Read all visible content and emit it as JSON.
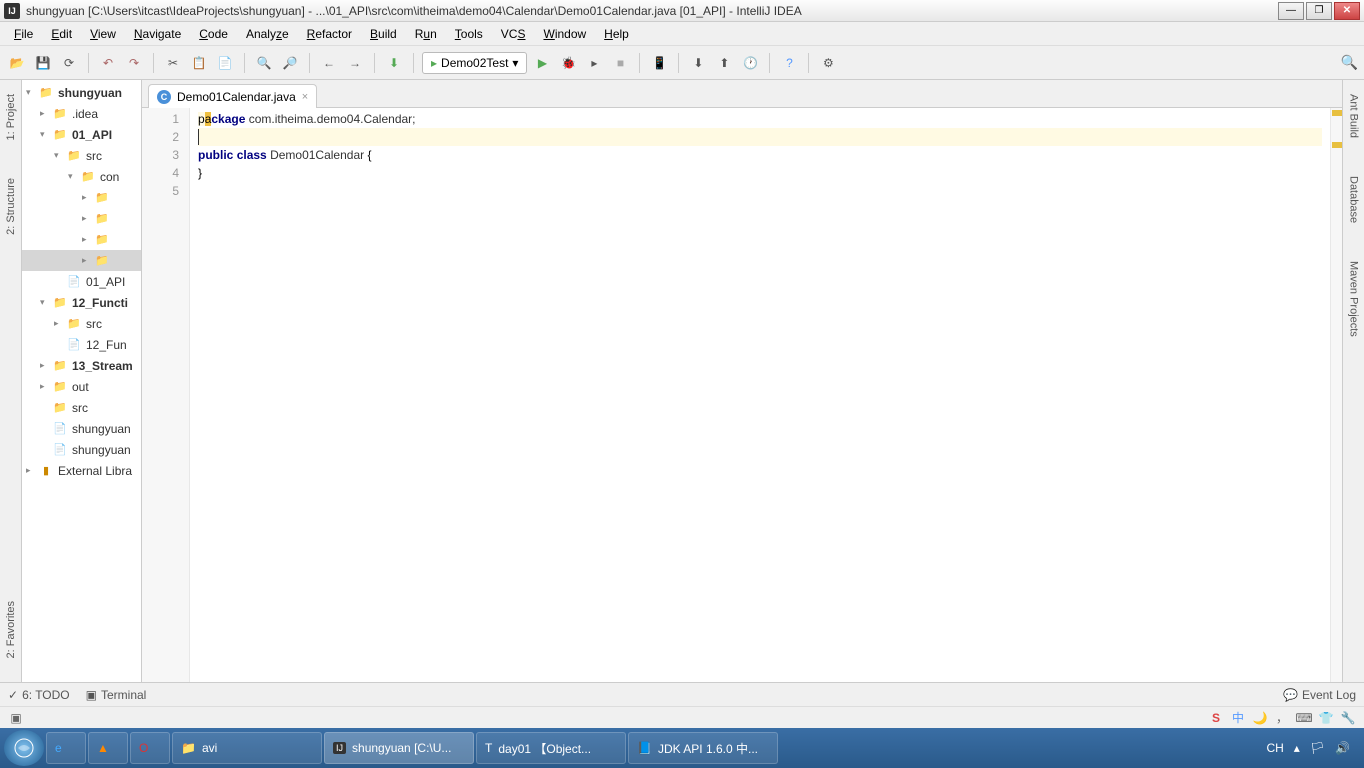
{
  "title": "shungyuan [C:\\Users\\itcast\\IdeaProjects\\shungyuan] - ...\\01_API\\src\\com\\itheima\\demo04\\Calendar\\Demo01Calendar.java [01_API] - IntelliJ IDEA",
  "menus": [
    "File",
    "Edit",
    "View",
    "Navigate",
    "Code",
    "Analyze",
    "Refactor",
    "Build",
    "Run",
    "Tools",
    "VCS",
    "Window",
    "Help"
  ],
  "runConfig": "Demo02Test",
  "leftGutter": [
    "1: Project",
    "2: Structure"
  ],
  "rightGutter": [
    "Ant Build",
    "Database",
    "Maven Projects"
  ],
  "leftGutterBottom": "2: Favorites",
  "tree": {
    "root": "shungyuan",
    "idea": ".idea",
    "api": "01_API",
    "src1": "src",
    "con": "con",
    "apiIml": "01_API",
    "func": "12_Functi",
    "src2": "src",
    "funcIml": "12_Fun",
    "stream": "13_Stream",
    "out": "out",
    "src3": "src",
    "iml1": "shungyuan",
    "iml2": "shungyuan",
    "ext": "External Libra"
  },
  "tabName": "Demo01Calendar.java",
  "lineNumbers": [
    "1",
    "2",
    "3",
    "4",
    "5"
  ],
  "code": {
    "l1_kw": "package",
    "l1_rest": " com.itheima.demo04.Calendar;",
    "l3_kw1": "public",
    "l3_kw2": "class",
    "l3_cls": "Demo01Calendar",
    "l3_brace": " {",
    "l4": "}"
  },
  "bottom": {
    "todo": "6: TODO",
    "terminal": "Terminal",
    "eventLog": "Event Log"
  },
  "taskbar": {
    "avi": "avi",
    "intellij": "shungyuan [C:\\U...",
    "day01": "day01 【Object...",
    "jdk": "JDK API 1.6.0 中...",
    "lang": "CH"
  }
}
